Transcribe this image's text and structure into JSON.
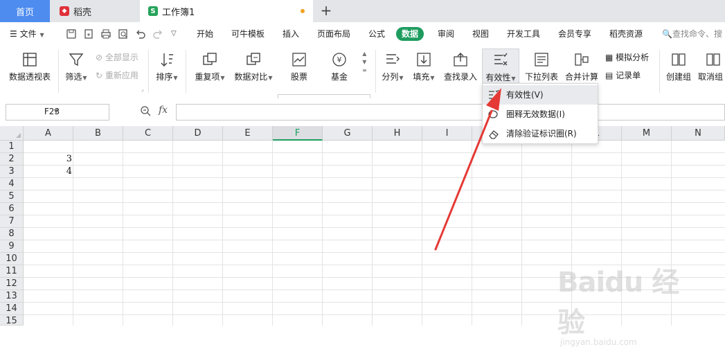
{
  "tabs": {
    "home": "首页",
    "daoke": "稻壳",
    "workbook": "工作簿1",
    "new_tab": "+"
  },
  "menu": {
    "file": "文件",
    "items": [
      "开始",
      "可牛模板",
      "插入",
      "页面布局",
      "公式",
      "数据",
      "审阅",
      "视图",
      "开发工具",
      "会员专享",
      "稻壳资源"
    ],
    "active": "数据",
    "search": "查找命令、搜"
  },
  "ribbon": {
    "pivot": "数据透视表",
    "filter": "筛选",
    "show_all": "全部显示",
    "reapply": "重新应用",
    "sort": "排序",
    "duplicates": "重复项",
    "compare": "数据对比",
    "stock": "股票",
    "fund": "基金",
    "split": "分列",
    "fill": "填充",
    "lookup": "查找录入",
    "validity": "有效性",
    "dropdown_list": "下拉列表",
    "consolidate": "合并计算",
    "simulate": "模拟分析",
    "record": "记录单",
    "group": "创建组",
    "ungroup": "取消组"
  },
  "formula_bar": {
    "name_box": "F23",
    "fx": "fx",
    "zoom_icon": "zoom-icon"
  },
  "columns": [
    "A",
    "B",
    "C",
    "D",
    "E",
    "F",
    "G",
    "H",
    "I",
    "J",
    "K",
    "L",
    "M",
    "N"
  ],
  "selected_column": "F",
  "rows": [
    "1",
    "2",
    "3",
    "4",
    "5",
    "6",
    "7",
    "8",
    "9",
    "10",
    "11",
    "12",
    "13",
    "14",
    "15"
  ],
  "cells": [
    {
      "ref": "A2",
      "value": "3"
    },
    {
      "ref": "A3",
      "value": "4"
    }
  ],
  "validity_menu": {
    "items": [
      "有效性(V)",
      "圈释无效数据(I)",
      "清除验证标识圈(R)"
    ]
  },
  "watermark": {
    "brand": "Baidu 经验",
    "url": "jingyan.baidu.com"
  },
  "colors": {
    "accent": "#1e9c60",
    "home_tab": "#4e8cf0",
    "arrow": "#e53935"
  }
}
